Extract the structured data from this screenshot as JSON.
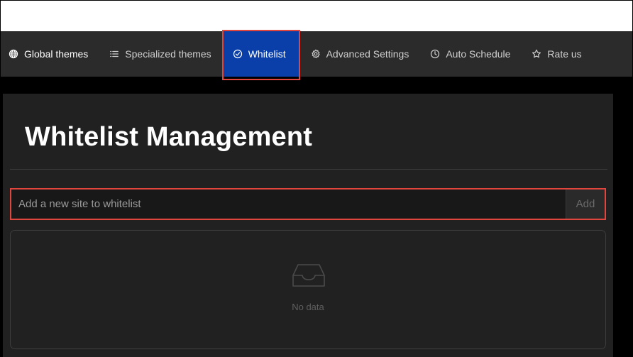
{
  "nav": {
    "items": [
      {
        "label": "Global themes",
        "icon": "globe-icon"
      },
      {
        "label": "Specialized themes",
        "icon": "list-icon"
      },
      {
        "label": "Whitelist",
        "icon": "check-circle-icon",
        "active": true
      },
      {
        "label": "Advanced Settings",
        "icon": "gear-icon"
      },
      {
        "label": "Auto Schedule",
        "icon": "clock-icon"
      },
      {
        "label": "Rate us",
        "icon": "star-icon"
      }
    ]
  },
  "main": {
    "title": "Whitelist Management",
    "input": {
      "placeholder": "Add a new site to whitelist",
      "value": ""
    },
    "add_label": "Add",
    "empty": {
      "icon": "inbox-icon",
      "text": "No data"
    }
  },
  "colors": {
    "active_tab": "#0a3faa",
    "highlight": "#e0463e",
    "nav_background": "#2b2b2b",
    "panel_background": "#212121"
  }
}
